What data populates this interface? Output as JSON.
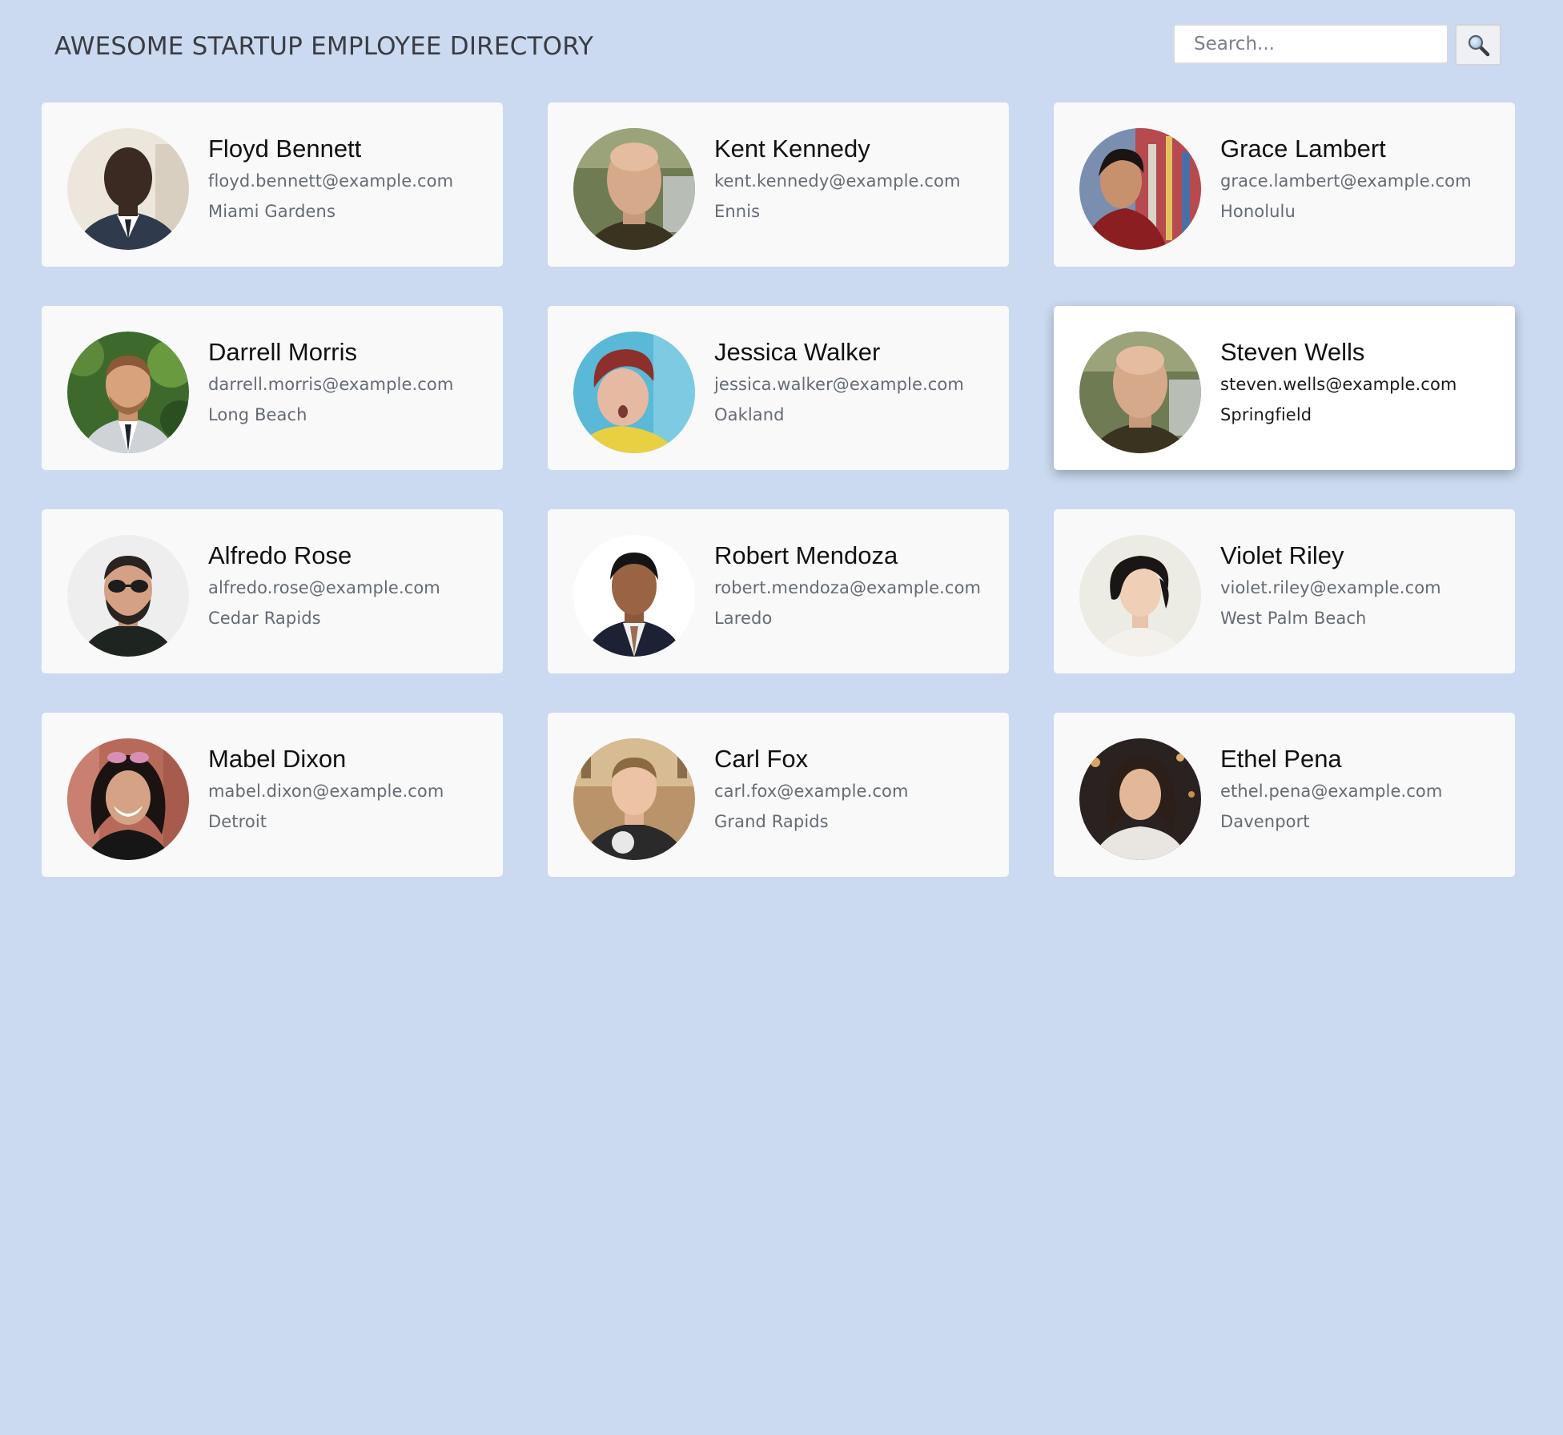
{
  "header": {
    "title": "AWESOME STARTUP EMPLOYEE DIRECTORY",
    "search_placeholder": "Search...",
    "search_icon": "magnifier-icon"
  },
  "employees": [
    {
      "name": "Floyd Bennett",
      "email": "floyd.bennett@example.com",
      "city": "Miami Gardens"
    },
    {
      "name": "Kent Kennedy",
      "email": "kent.kennedy@example.com",
      "city": "Ennis"
    },
    {
      "name": "Grace Lambert",
      "email": "grace.lambert@example.com",
      "city": "Honolulu"
    },
    {
      "name": "Darrell Morris",
      "email": "darrell.morris@example.com",
      "city": "Long Beach"
    },
    {
      "name": "Jessica Walker",
      "email": "jessica.walker@example.com",
      "city": "Oakland"
    },
    {
      "name": "Steven Wells",
      "email": "steven.wells@example.com",
      "city": "Springfield",
      "highlighted": true
    },
    {
      "name": "Alfredo Rose",
      "email": "alfredo.rose@example.com",
      "city": "Cedar Rapids"
    },
    {
      "name": "Robert Mendoza",
      "email": "robert.mendoza@example.com",
      "city": "Laredo"
    },
    {
      "name": "Violet Riley",
      "email": "violet.riley@example.com",
      "city": "West Palm Beach"
    },
    {
      "name": "Mabel Dixon",
      "email": "mabel.dixon@example.com",
      "city": "Detroit"
    },
    {
      "name": "Carl Fox",
      "email": "carl.fox@example.com",
      "city": "Grand Rapids"
    },
    {
      "name": "Ethel Pena",
      "email": "ethel.pena@example.com",
      "city": "Davenport"
    }
  ],
  "colors": {
    "page_background": "#cbdaf0",
    "card_background": "#f9f9f9",
    "card_highlight": "#ffffff"
  }
}
